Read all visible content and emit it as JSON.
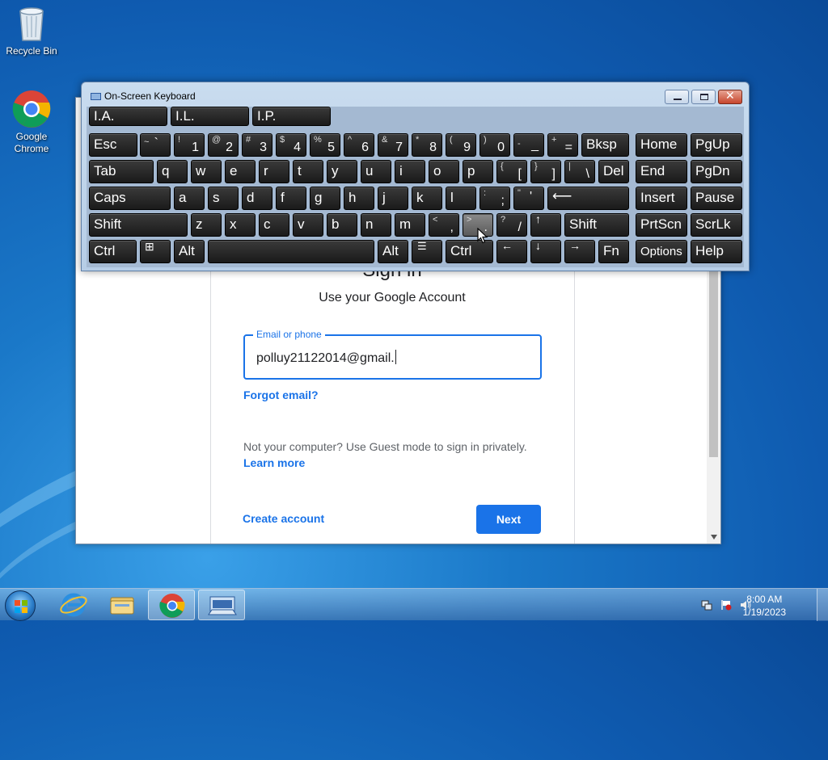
{
  "desktop": {
    "icons": [
      {
        "label": "Recycle Bin",
        "icon": "recycle-bin-icon"
      },
      {
        "label": "Google Chrome",
        "icon": "chrome-icon"
      }
    ]
  },
  "browser": {
    "title": "Sign in",
    "subtitle": "Use your Google Account",
    "email_label": "Email or phone",
    "email_value": "polluy21122014@gmail.",
    "forgot_email": "Forgot email?",
    "guest_note": "Not your computer? Use Guest mode to sign in privately.",
    "learn_more": "Learn more",
    "create_account": "Create account",
    "next": "Next",
    "accent_color": "#1a73e8"
  },
  "osk": {
    "title": "On-Screen Keyboard",
    "predictions": [
      "I.A.",
      "I.L.",
      "I.P."
    ],
    "keys": {
      "esc": "Esc",
      "tilde_hi": "~",
      "tilde_lo": "`",
      "n1_hi": "!",
      "n1": "1",
      "n2_hi": "@",
      "n2": "2",
      "n3_hi": "#",
      "n3": "3",
      "n4_hi": "$",
      "n4": "4",
      "n5_hi": "%",
      "n5": "5",
      "n6_hi": "^",
      "n6": "6",
      "n7_hi": "&",
      "n7": "7",
      "n8_hi": "*",
      "n8": "8",
      "n9_hi": "(",
      "n9": "9",
      "n0_hi": ")",
      "n0": "0",
      "minus_hi": "-",
      "minus": "_",
      "eq_hi": "+",
      "eq": "=",
      "bksp": "Bksp",
      "home": "Home",
      "pgup": "PgUp",
      "tab": "Tab",
      "q": "q",
      "w": "w",
      "e": "e",
      "r": "r",
      "t": "t",
      "y": "y",
      "u": "u",
      "i": "i",
      "o": "o",
      "p": "p",
      "lbr_hi": "{",
      "lbr": "[",
      "rbr_hi": "}",
      "rbr": "]",
      "bsl_hi": "|",
      "bsl": "\\",
      "del": "Del",
      "end": "End",
      "pgdn": "PgDn",
      "caps": "Caps",
      "a": "a",
      "s": "s",
      "d": "d",
      "f": "f",
      "g": "g",
      "h": "h",
      "j": "j",
      "k": "k",
      "l": "l",
      "semi_hi": ":",
      "semi": ";",
      "quote_hi": "\"",
      "quote": "'",
      "enter": "⟵",
      "insert": "Insert",
      "pause": "Pause",
      "shift": "Shift",
      "z": "z",
      "x": "x",
      "c": "c",
      "v": "v",
      "b": "b",
      "n": "n",
      "m": "m",
      "comma_hi": "<",
      "comma": ",",
      "period_hi": ">",
      "period": ".",
      "slash_hi": "?",
      "slash": "/",
      "up": "↑",
      "rshift": "Shift",
      "prtscn": "PrtScn",
      "scrlk": "ScrLk",
      "ctrl": "Ctrl",
      "win": "⊞",
      "alt": "Alt",
      "ralt": "Alt",
      "menu": "☰",
      "rctrl": "Ctrl",
      "left": "←",
      "down": "↓",
      "right": "→",
      "fn": "Fn",
      "options": "Options",
      "help": "Help"
    }
  },
  "taskbar": {
    "time": "8:00 AM",
    "date": "1/19/2023",
    "apps": [
      "start",
      "internet-explorer",
      "windows-explorer",
      "google-chrome",
      "on-screen-keyboard"
    ]
  }
}
